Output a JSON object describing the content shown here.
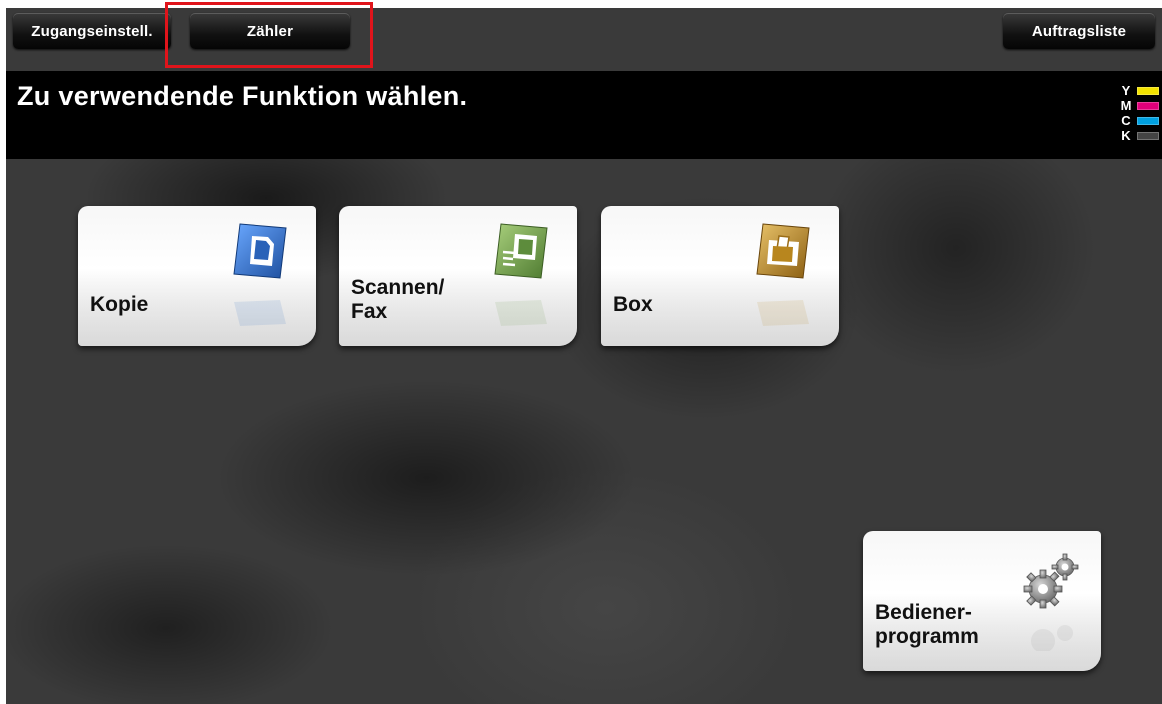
{
  "header": {
    "access_settings_label": "Zugangseinstell.",
    "counter_label": "Zähler",
    "job_list_label": "Auftragsliste"
  },
  "title_bar": {
    "message": "Zu verwendende Funktion wählen."
  },
  "toner": [
    {
      "letter": "Y",
      "color": "#f2e200"
    },
    {
      "letter": "M",
      "color": "#e0007a"
    },
    {
      "letter": "C",
      "color": "#00a0e0"
    },
    {
      "letter": "K",
      "color": "#333333"
    }
  ],
  "tiles": {
    "copy": {
      "line1": "Kopie",
      "icon": "copy-document-icon",
      "color": "#2f6fc2"
    },
    "scan_fax": {
      "line1": "Scannen/",
      "line2": "Fax",
      "icon": "scan-fax-icon",
      "color": "#6a9a4a"
    },
    "box": {
      "line1": "Box",
      "icon": "box-folder-icon",
      "color": "#b8861e"
    },
    "utility": {
      "line1": "Bediener-",
      "line2": "programm",
      "icon": "gears-icon",
      "color": "#8a8a8a"
    }
  }
}
